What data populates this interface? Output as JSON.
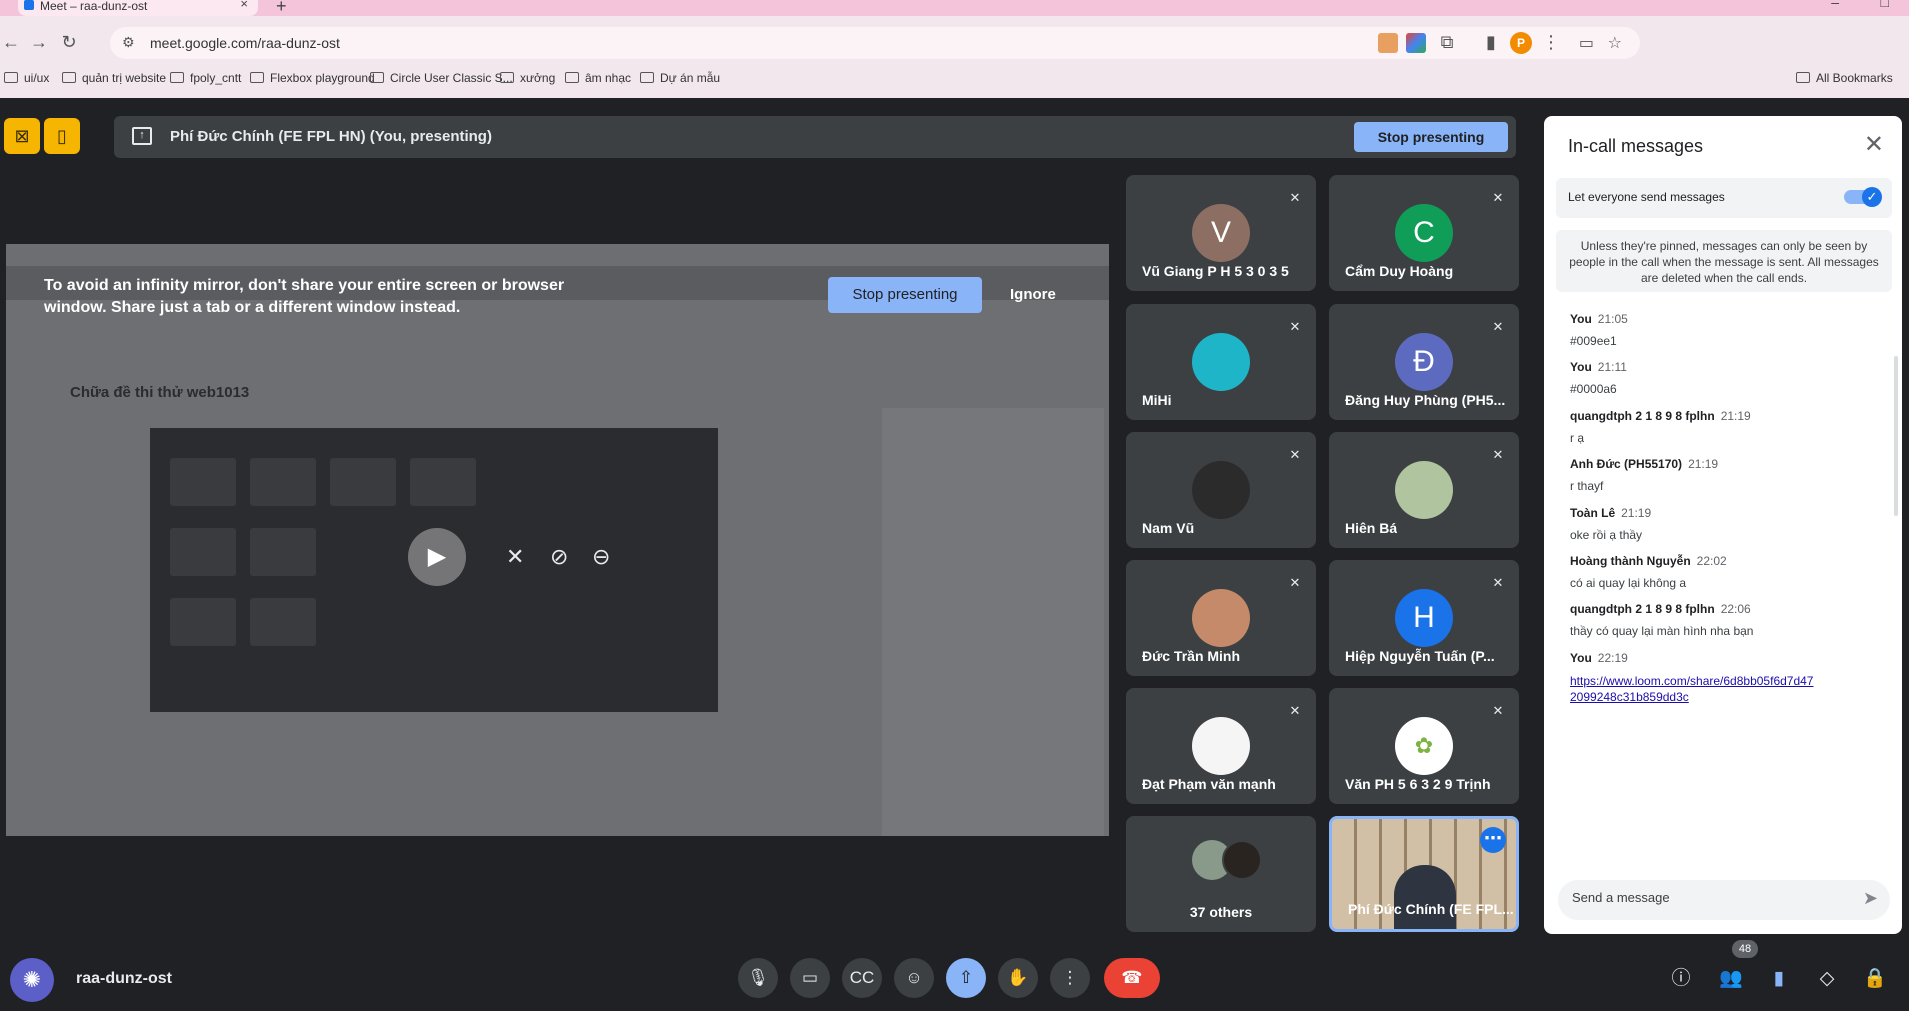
{
  "browser": {
    "tab_title": "Meet – raa-dunz-ost",
    "url": "meet.google.com/raa-dunz-ost",
    "profile_initial": "P",
    "bookmarks": [
      "ui/ux",
      "quản trị website",
      "fpoly_cntt",
      "Flexbox playground",
      "Circle User Classic S...",
      "xưởng",
      "âm nhạc",
      "Dự án mẫu"
    ],
    "all_bookmarks": "All Bookmarks"
  },
  "presenting": {
    "label": "Phí Đức Chính (FE FPL HN) (You, presenting)",
    "stop_label": "Stop presenting"
  },
  "shared_screen": {
    "infinity_warning": "To avoid an infinity mirror, don't share your entire screen or browser window. Share just a tab or a different window instead.",
    "stop_label": "Stop presenting",
    "ignore_label": "Ignore",
    "doc_title": "Chữa đề thi thử web1013"
  },
  "participants": [
    {
      "name": "Vũ Giang P H 5 3 0 3 5",
      "initial": "V",
      "color": "#8d6e63"
    },
    {
      "name": "Cẩm Duy Hoàng",
      "initial": "C",
      "color": "#0f9d58"
    },
    {
      "name": "MiHi",
      "initial": "",
      "color": "#1fb5c8"
    },
    {
      "name": "Đăng Huy Phùng (PH5...",
      "initial": "Đ",
      "color": "#5c6bc0"
    },
    {
      "name": "Nam Vũ",
      "initial": "",
      "color": "#2b2b2b"
    },
    {
      "name": "Hiên Bá",
      "initial": "",
      "color": "#b0c4a0"
    },
    {
      "name": "Đức Trần Minh",
      "initial": "",
      "color": "#c48a6a"
    },
    {
      "name": "Hiệp Nguyễn Tuấn (P...",
      "initial": "H",
      "color": "#1a73e8"
    },
    {
      "name": "Đạt Phạm văn mạnh",
      "initial": "",
      "color": "#f5f5f5"
    },
    {
      "name": "Văn PH 5 6 3 2 9 Trịnh",
      "initial": "",
      "color": "#ffffff"
    }
  ],
  "others_label": "37 others",
  "self_tile_name": "Phí Đức Chính (FE FPL...",
  "chat": {
    "title": "In-call messages",
    "toggle_label": "Let everyone send messages",
    "toggle_on": true,
    "notice": "Unless they're pinned, messages can only be seen by people in the call when the message is sent. All messages are deleted when the call ends.",
    "messages": [
      {
        "sender": "You",
        "time": "21:05",
        "text": "#009ee1"
      },
      {
        "sender": "You",
        "time": "21:11",
        "text": "#0000a6"
      },
      {
        "sender": "quangdtph 2 1 8 9 8 fplhn",
        "time": "21:19",
        "text": "r ạ"
      },
      {
        "sender": "Anh Đức (PH55170)",
        "time": "21:19",
        "text": "r thayf"
      },
      {
        "sender": "Toàn Lê",
        "time": "21:19",
        "text": "oke rồi ạ thầy"
      },
      {
        "sender": "Hoàng thành Nguyễn",
        "time": "22:02",
        "text": "có ai quay lại không a"
      },
      {
        "sender": "quangdtph 2 1 8 9 8 fplhn",
        "time": "22:06",
        "text": "thầy có quay lại màn hình nha bạn"
      },
      {
        "sender": "You",
        "time": "22:19",
        "link": "https://www.loom.com/share/6d8bb05f6d7d472099248c31b859dd3c"
      }
    ],
    "input_placeholder": "Send a message"
  },
  "meeting": {
    "code": "raa-dunz-ost",
    "participant_count": "48"
  }
}
